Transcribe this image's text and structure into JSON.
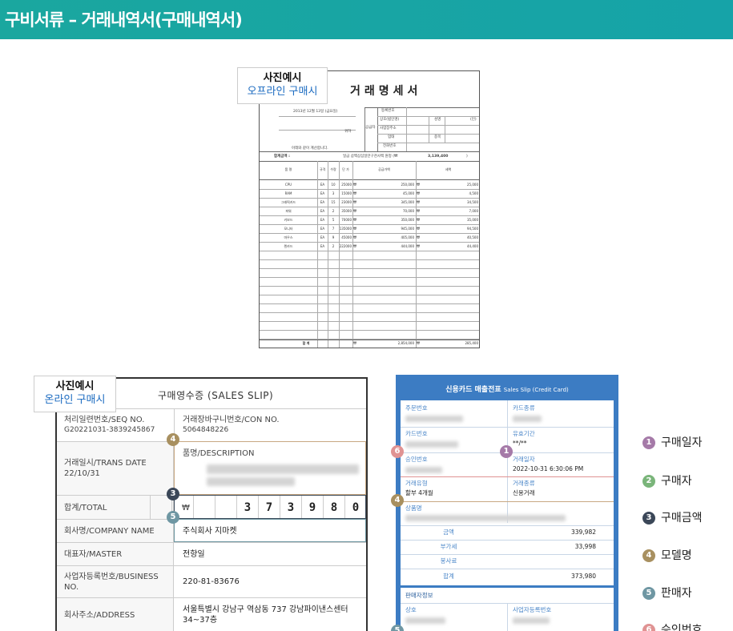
{
  "header": {
    "title": "구비서류 – 거래내역서(구매내역서)"
  },
  "captions": {
    "offline": {
      "line1": "사진예시",
      "line2": "오프라인 구매시"
    },
    "online": {
      "line1": "사진예시",
      "line2": "온라인 구매시"
    }
  },
  "invoice": {
    "title": "거래명세서",
    "date": "2013년 12월 13일 (금요일)",
    "recipient_suffix": "귀하",
    "note": "아래와 같이 계산합니다.",
    "supplier_label": "공급자",
    "supplier_fields": [
      "등록번호",
      "상호(법인명)",
      "사업장주소",
      "업태",
      "전화번호"
    ],
    "supplier_field_right": [
      "성명",
      "종목"
    ],
    "seal": "(인)",
    "total_label": "합계금액 :",
    "total_text": "일금 삼백삼십일만구천사백 원정 (₩",
    "total_value": "3,139,400",
    "total_close": ")",
    "columns": [
      "품  명",
      "규격",
      "수량",
      "단 가",
      "공급가액",
      "세액"
    ],
    "rows": [
      {
        "name": "CPU",
        "unit": "EA",
        "qty": "10",
        "price": "25000",
        "supply": "250,000",
        "tax": "25,000"
      },
      {
        "name": "RAM",
        "unit": "EA",
        "qty": "3",
        "price": "15000",
        "supply": "45,000",
        "tax": "4,500"
      },
      {
        "name": "그래픽카드",
        "unit": "EA",
        "qty": "15",
        "price": "23000",
        "supply": "345,000",
        "tax": "34,500"
      },
      {
        "name": "파워",
        "unit": "EA",
        "qty": "2",
        "price": "35000",
        "supply": "70,000",
        "tax": "7,000"
      },
      {
        "name": "키보드",
        "unit": "EA",
        "qty": "5",
        "price": "70000",
        "supply": "350,000",
        "tax": "35,000"
      },
      {
        "name": "모니터",
        "unit": "EA",
        "qty": "7",
        "price": "135000",
        "supply": "945,000",
        "tax": "94,500"
      },
      {
        "name": "마우스",
        "unit": "EA",
        "qty": "9",
        "price": "45000",
        "supply": "405,000",
        "tax": "40,500"
      },
      {
        "name": "렌카드",
        "unit": "EA",
        "qty": "2",
        "price": "222000",
        "supply": "444,000",
        "tax": "44,400"
      }
    ],
    "currency": "₩",
    "sum_label": "합  계",
    "sum_supply": "2,854,000",
    "sum_tax": "285,400"
  },
  "slip": {
    "title": "구매영수증 (SALES SLIP)",
    "seq_label": "처리일련번호/SEQ NO.",
    "seq_value": "G20221031-3839245867",
    "con_label": "거래장바구니번호/CON NO.",
    "con_value": "5064848226",
    "trans_label": "거래일시/TRANS DATE",
    "trans_value": "22/10/31",
    "desc_label": "품명/DESCRIPTION",
    "total_label": "합계/TOTAL",
    "currency": "₩",
    "total_digits": [
      "3",
      "7",
      "3",
      "9",
      "8",
      "0"
    ],
    "company_label": "회사명/COMPANY NAME",
    "company_value": "주식회사 지마켓",
    "master_label": "대표자/MASTER",
    "master_value": "전항일",
    "bizno_label_1": "사업자등록번호/BUSINESS",
    "bizno_label_2": "NO.",
    "bizno_value": "220-81-83676",
    "addr_label": "회사주소/ADDRESS",
    "addr_value_1": "서울특별시 강남구 역삼동 737 강남파이낸스센터",
    "addr_value_2": "34~37층"
  },
  "cc": {
    "title": "신용카드 매출전표",
    "subtitle": "Sales Slip (Credit Card)",
    "order_no_label": "주문번호",
    "card_type_label": "카드종류",
    "card_no_label": "카드번호",
    "valid_label": "유효기간",
    "valid_value": "**/**",
    "approval_label": "승인번호",
    "trade_date_label": "거래일자",
    "trade_date_value": "2022-10-31 6:30:06 PM",
    "trade_type_label": "거래유형",
    "trade_type_value": "할부 4개월",
    "trade_kind_label": "거래종류",
    "trade_kind_value": "신용거래",
    "product_label": "상품명",
    "amount_label": "금액",
    "amount_value": "339,982",
    "vat_label": "부가세",
    "vat_value": "33,998",
    "service_label": "봉사료",
    "service_value": "",
    "sum_label": "합계",
    "sum_value": "373,980",
    "seller_section": "판매자정보",
    "seller_name_label": "상호",
    "seller_bizno_label": "사업자등록번호"
  },
  "legend": [
    {
      "num": "1",
      "label": "구매일자"
    },
    {
      "num": "2",
      "label": "구매자"
    },
    {
      "num": "3",
      "label": "구매금액"
    },
    {
      "num": "4",
      "label": "모델명"
    },
    {
      "num": "5",
      "label": "판매자"
    },
    {
      "num": "6",
      "label": "승인번호"
    }
  ],
  "colors": {
    "header": "#1aa79f",
    "m1": "#a57aa8",
    "m2": "#7ab57a",
    "m3": "#3b4758",
    "m4": "#a89060",
    "m5": "#6f97a3",
    "m6": "#e09393",
    "card_blue": "#3c7cc3"
  }
}
